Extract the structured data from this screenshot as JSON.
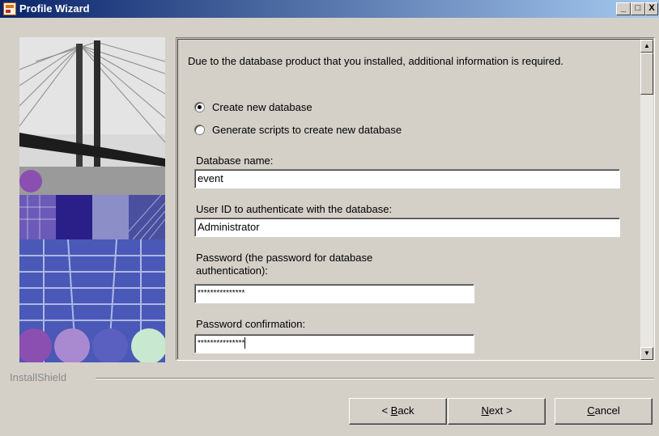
{
  "window": {
    "title": "Profile Wizard",
    "buttons": {
      "minimize": "_",
      "maximize": "□",
      "close": "X"
    }
  },
  "content": {
    "intro": "Due to the database product that you installed, additional information is required.",
    "radio_options": [
      {
        "label": "Create new database",
        "selected": true
      },
      {
        "label": "Generate scripts to create new database",
        "selected": false
      }
    ],
    "fields": {
      "database_name": {
        "label": "Database name:",
        "value": "event"
      },
      "user_id": {
        "label": "User ID to authenticate with the database:",
        "value": "Administrator"
      },
      "password": {
        "label": "Password (the password for database authentication):",
        "value": "***************"
      },
      "password_confirm": {
        "label": "Password confirmation:",
        "value": "***************"
      }
    }
  },
  "footer": {
    "installshield": "InstallShield",
    "back": {
      "prefix": "< ",
      "mnemonic": "B",
      "rest": "ack"
    },
    "next": {
      "mnemonic": "N",
      "rest": "ext >"
    },
    "cancel": {
      "mnemonic": "C",
      "rest": "ancel"
    }
  },
  "colors": {
    "title_gradient_start": "#0a246a",
    "title_gradient_end": "#a6caf0",
    "dialog_face": "#d4d0c8"
  }
}
